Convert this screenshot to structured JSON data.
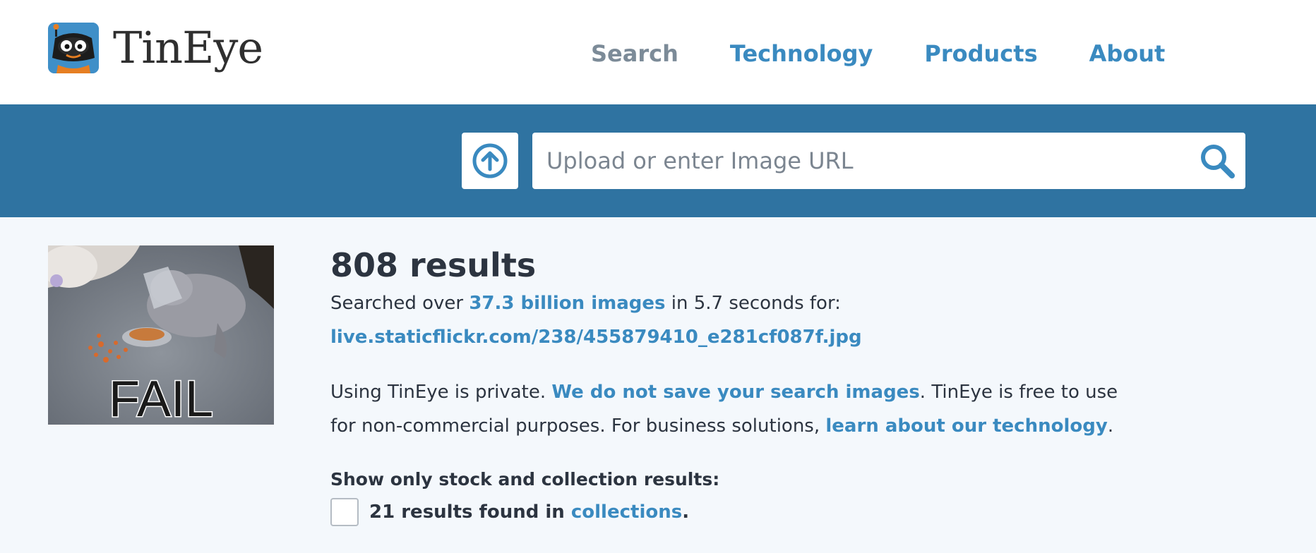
{
  "header": {
    "brand": "TinEye",
    "logo_icon": "tineye-robot-logo-icon",
    "nav": {
      "search": "Search",
      "technology": "Technology",
      "products": "Products",
      "about": "About"
    }
  },
  "search": {
    "upload_icon": "upload-arrow-icon",
    "placeholder": "Upload or enter Image URL",
    "submit_icon": "magnifier-icon"
  },
  "results": {
    "count_text": "808 results",
    "searched_prefix": "Searched over ",
    "searched_link": "37.3 billion images",
    "searched_suffix": " in 5.7 seconds for:",
    "query_url": "live.staticflickr.com/238/455879410_e281cf087f.jpg",
    "query_image_caption": "FAIL"
  },
  "privacy": {
    "prefix": "Using TinEye is private. ",
    "link1": "We do not save your search images",
    "middle": ". TinEye is free to use for non-commercial purposes. For business solutions, ",
    "link2": "learn about our technology",
    "suffix": "."
  },
  "filter": {
    "title": "Show only stock and collection results:",
    "prefix": "21 results found in ",
    "link": "collections",
    "suffix": "."
  },
  "colors": {
    "brand_blue": "#2f73a1",
    "link_blue": "#3a8ac0",
    "page_bg": "#f4f8fc",
    "text_dark": "#2c3440"
  }
}
